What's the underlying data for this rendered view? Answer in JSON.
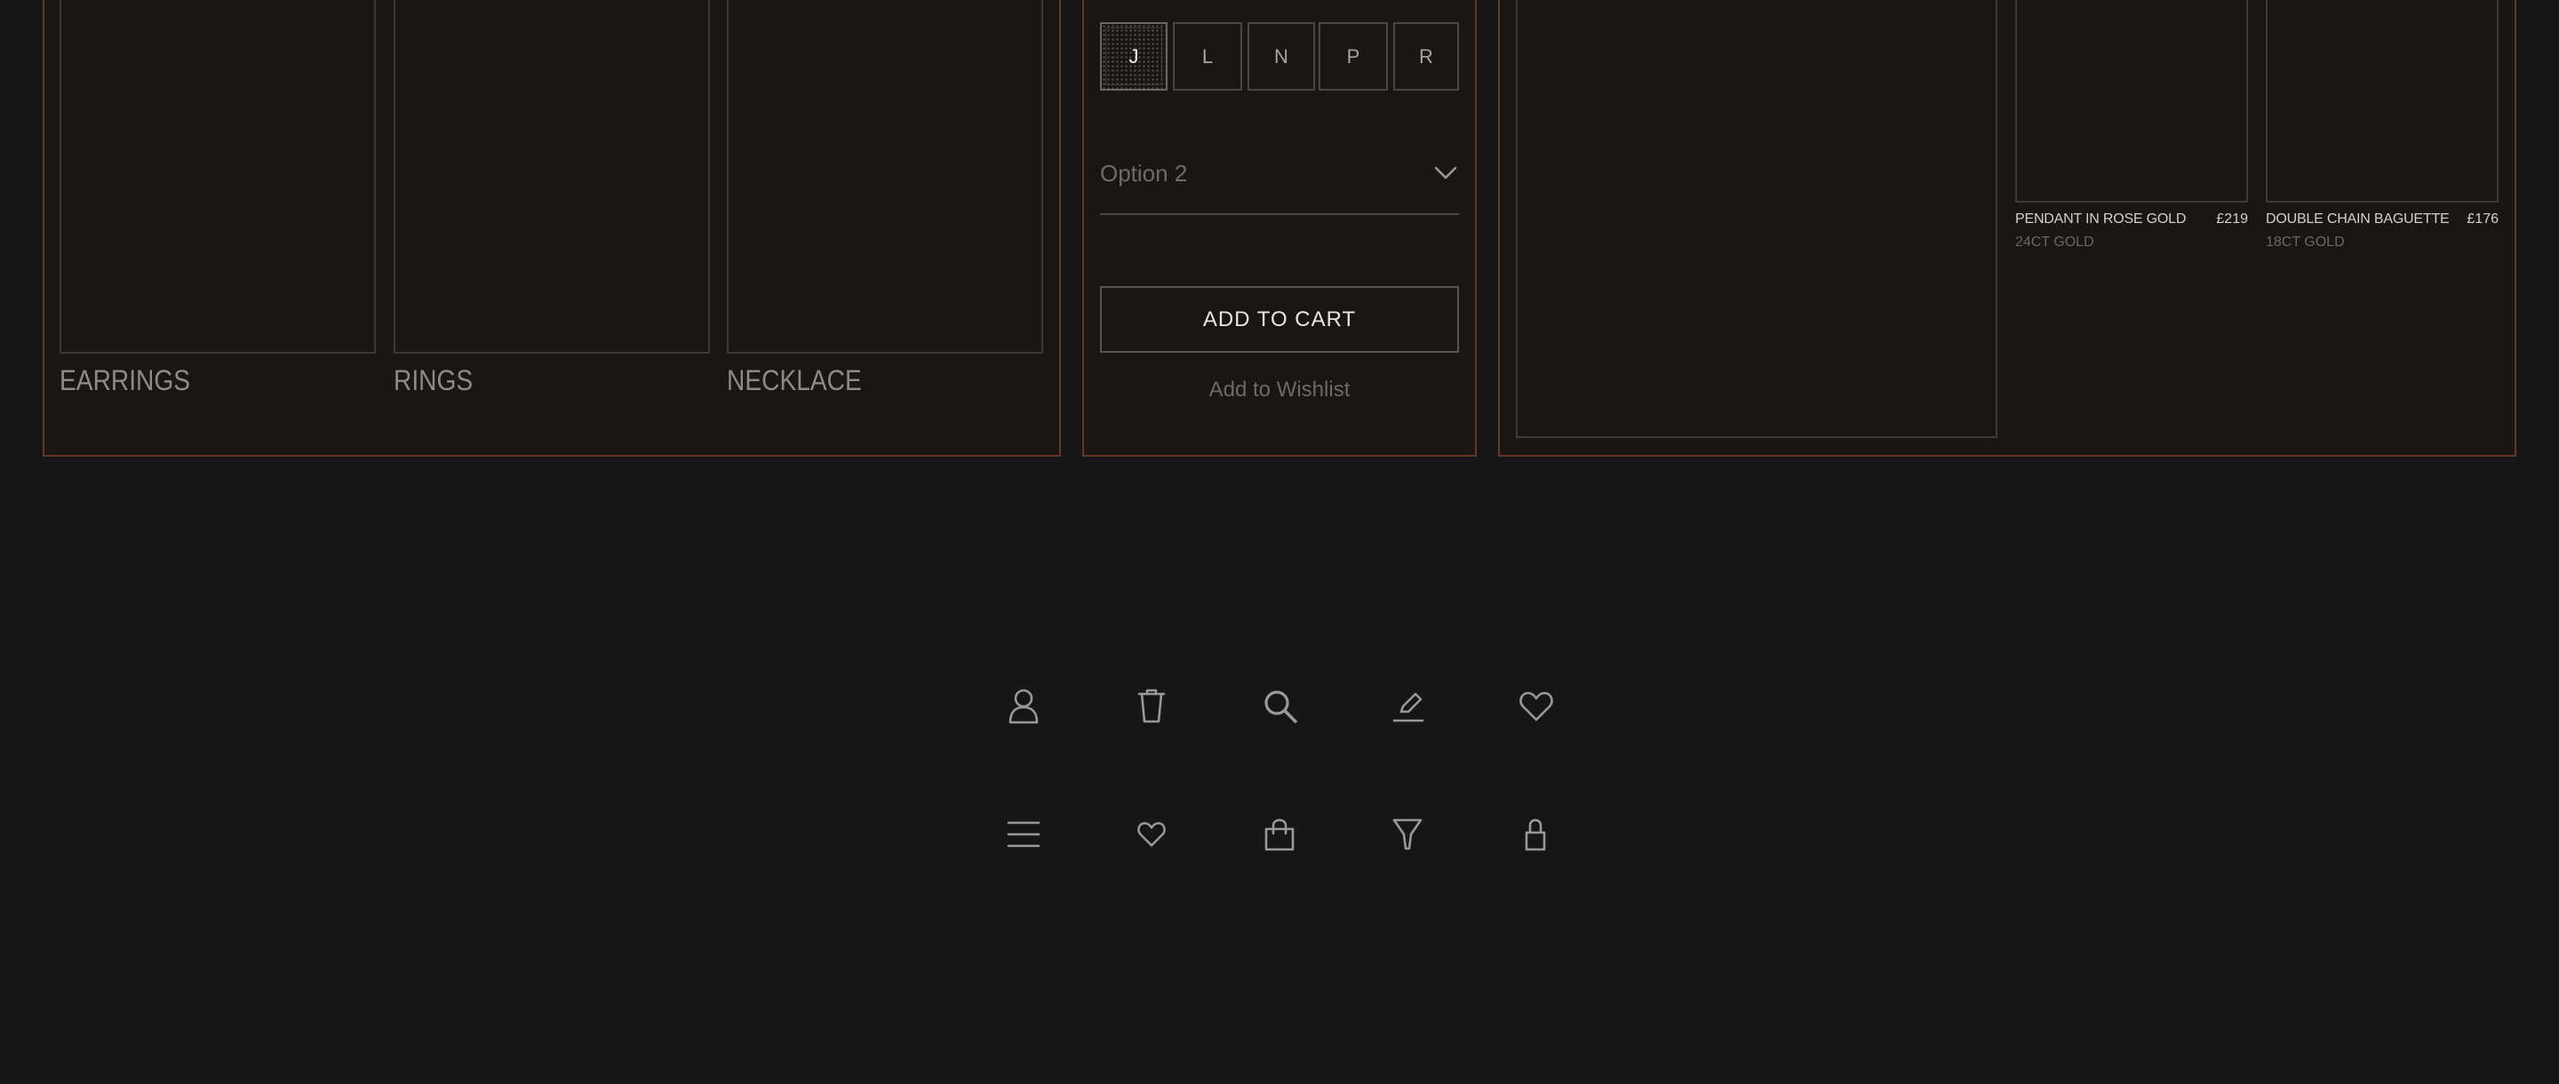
{
  "categories": [
    {
      "label": "EARRINGS"
    },
    {
      "label": "RINGS"
    },
    {
      "label": "NECKLACE"
    }
  ],
  "product_form": {
    "sizes": [
      {
        "label": "J",
        "selected": true
      },
      {
        "label": "L",
        "selected": false
      },
      {
        "label": "N",
        "selected": false
      },
      {
        "label": "P",
        "selected": false
      },
      {
        "label": "R",
        "selected": false
      }
    ],
    "option_select": {
      "value": "Option 2"
    },
    "add_to_cart_label": "ADD TO CART",
    "wishlist_label": "Add to Wishlist"
  },
  "related_products": [
    {
      "name": "PENDANT IN ROSE GOLD",
      "price": "£219",
      "material": "24CT GOLD"
    },
    {
      "name": "DOUBLE CHAIN BAGUETTE",
      "price": "£176",
      "material": "18CT GOLD"
    }
  ],
  "icon_set": {
    "row1": [
      "user-icon",
      "trash-icon",
      "search-icon",
      "edit-icon",
      "heart-icon"
    ],
    "row2": [
      "menu-icon",
      "heart-small-icon",
      "shopping-bag-icon",
      "filter-icon",
      "lock-icon"
    ]
  },
  "colors": {
    "background": "#161616",
    "panel_border": "#6a3522",
    "thumb_border": "#3d3939",
    "text_muted": "#8e8a87",
    "icon_stroke": "#9c9896"
  }
}
